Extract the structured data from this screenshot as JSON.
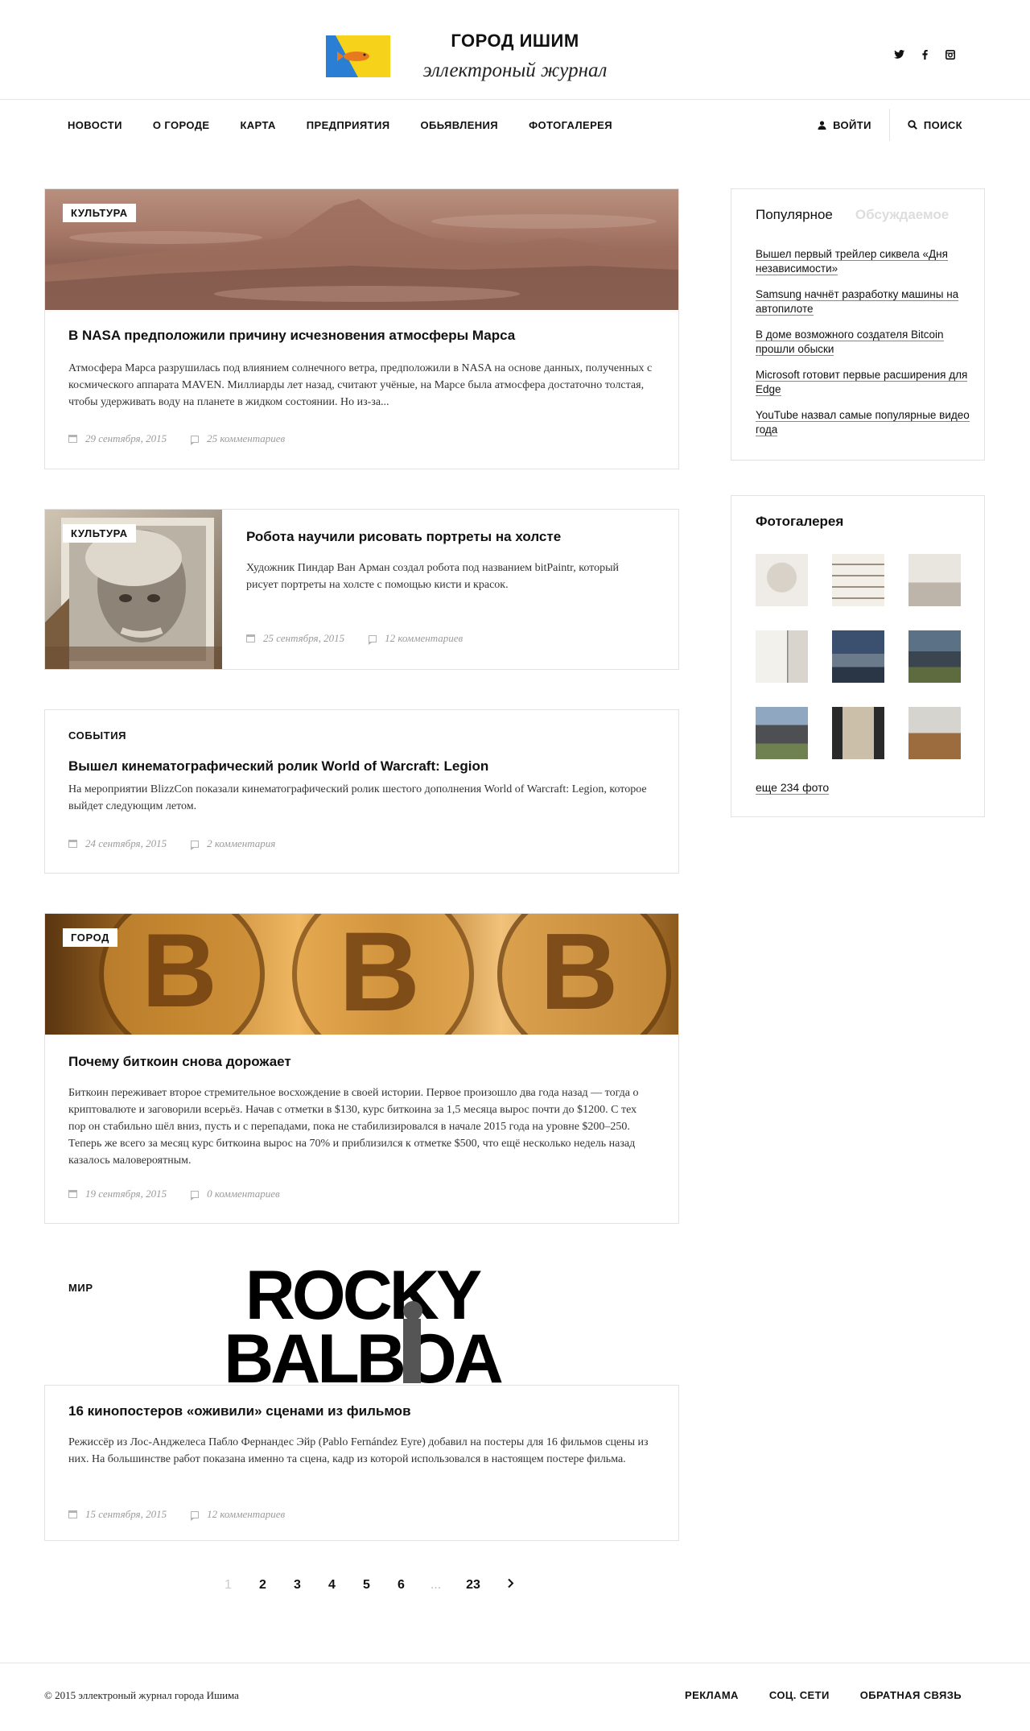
{
  "header": {
    "title": "ГОРОД ИШИМ",
    "subtitle": "эллектроный журнал",
    "logo_colors": {
      "blue": "#2a7fd4",
      "yellow": "#f6d31a"
    },
    "socials": [
      "twitter-icon",
      "facebook-icon",
      "instagram-icon"
    ]
  },
  "nav": {
    "items": [
      "НОВОСТИ",
      "О ГОРОДЕ",
      "КАРТА",
      "ПРЕДПРИЯТИЯ",
      "ОБЬЯВЛЕНИЯ",
      "ФОТОГАЛЕРЕЯ"
    ],
    "login": "ВОЙТИ",
    "search": "ПОИСК"
  },
  "articles": [
    {
      "tag": "КУЛЬТУРА",
      "title": "В NASA предположили причину исчезновения атмосферы Марса",
      "text": "Атмосфера Марса разрушилась под влиянием солнечного ветра, предположили в NASA на основе данных, полученных с космического аппарата MAVEN. Миллиарды лет назад, считают учёные, на Марсе была атмосфера достаточно толстая, чтобы удерживать воду на планете в жидком состоянии. Но из-за...",
      "date": "29 сентября, 2015",
      "comments": "25 комментариев"
    },
    {
      "tag": "КУЛЬТУРА",
      "title": "Робота научили рисовать портреты на холсте",
      "text": "Художник Пиндар Ван Арман создал робота под названием bitPaintr, который рисует портреты на холсте с помощью кисти и красок.",
      "date": "25 сентября, 2015",
      "comments": "12 комментариев"
    },
    {
      "tag": "СОБЫТИЯ",
      "title": "Вышел кинематографический ролик World of Warcraft: Legion",
      "text": "На мероприятии BlizzCon показали кинематографический ролик шестого дополнения World of Warcraft: Legion, которое выйдет следующим летом.",
      "date": "24 сентября, 2015",
      "comments": "2 комментария"
    },
    {
      "tag": "ГОРОД",
      "title": "Почему биткоин снова дорожает",
      "text": "Биткоин переживает второе стремительное восхождение в своей истории. Первое произошло два года назад — тогда о криптовалюте и заговорили всерьёз. Начав с отметки в $130, курс биткоина за 1,5 месяца вырос почти до $1200. С тех пор он стабильно шёл вниз, пусть и с перепадами, пока не стабилизировался в начале 2015 года на уровне $200–250. Теперь же всего за месяц курс биткоина вырос на 70% и приблизился к отметке $500, что ещё несколько недель назад казалось маловероятным.",
      "date": "19 сентября, 2015",
      "comments": "0 комментариев"
    },
    {
      "tag": "МИР",
      "poster_line1": "ROCKY",
      "poster_line2": "BALBOA",
      "title": "16 кинопостеров «оживили» сценами из фильмов",
      "text": "Режиссёр из Лос-Анджелеса Пабло Фернандес Эйр (Pablo Fernández Eyre) добавил на постеры для 16 фильмов сцены из них. На большинстве работ показана именно та сцена, кадр из которой использовался в настоящем постере фильма.",
      "date": "15 сентября, 2015",
      "comments": "12 комментариев"
    }
  ],
  "sidebar": {
    "tab_active": "Популярное",
    "tab_inactive": "Обсуждаемое",
    "popular": [
      "Вышел первый трейлер сиквела «Дня независимости»",
      "Samsung начнёт разработку машины на автопилоте",
      "В доме возможного создателя Bitcoin прошли обыски",
      "Microsoft готовит первые расширения для Edge",
      "YouTube назвал самые популярные видео года"
    ],
    "gallery_title": "Фотогалерея",
    "gallery_more": "еще 234 фото"
  },
  "pagination": [
    "1",
    "2",
    "3",
    "4",
    "5",
    "6",
    "...",
    "23"
  ],
  "footer": {
    "copyright": "© 2015 эллектроный журнал города Ишима",
    "links": [
      "РЕКЛАМА",
      "СОЦ. СЕТИ",
      "ОБРАТНАЯ СВЯЗЬ"
    ]
  }
}
